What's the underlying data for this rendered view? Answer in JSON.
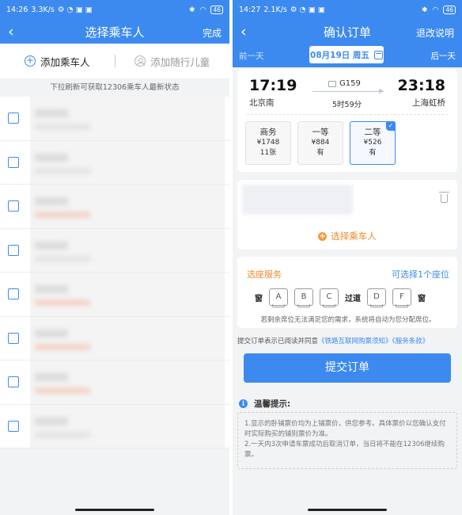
{
  "left": {
    "status": {
      "time": "14:26",
      "speed": "3.3K/s",
      "battery": "46"
    },
    "nav": {
      "back": "‹",
      "title": "选择乘车人",
      "done": "完成"
    },
    "add": {
      "add_passenger": "添加乘车人",
      "add_child": "添加随行儿童"
    },
    "hint": "下拉刷新可获取12306乘车人最新状态",
    "passengers": [
      {
        "name": "",
        "id": ""
      },
      {
        "name": "",
        "id": ""
      },
      {
        "name": "",
        "id": ""
      },
      {
        "name": "",
        "id": ""
      },
      {
        "name": "",
        "id": ""
      },
      {
        "name": "",
        "id": ""
      },
      {
        "name": "",
        "id": ""
      },
      {
        "name": "",
        "id": ""
      }
    ]
  },
  "right": {
    "status": {
      "time": "14:27",
      "speed": "2.1K/s",
      "battery": "46"
    },
    "nav": {
      "back": "‹",
      "title": "确认订单",
      "refund": "退改说明"
    },
    "date": {
      "prev": "前一天",
      "current": "08月19日 周五",
      "next": "后一天"
    },
    "train": {
      "depart_time": "17:19",
      "depart_station": "北京南",
      "arrive_time": "23:18",
      "arrive_station": "上海虹桥",
      "number": "G159",
      "duration": "5时59分"
    },
    "seats": [
      {
        "name": "商务",
        "price": "¥1748",
        "avail": "11张",
        "selected": false
      },
      {
        "name": "一等",
        "price": "¥884",
        "avail": "有",
        "selected": false
      },
      {
        "name": "二等",
        "price": "¥526",
        "avail": "有",
        "selected": true
      }
    ],
    "select_passenger": "选择乘车人",
    "service": {
      "title": "选座服务",
      "limit": "可选择1个座位",
      "window": "窗",
      "aisle": "过道",
      "seats": [
        "A",
        "B",
        "C",
        "D",
        "F"
      ],
      "note": "若剩余席位无法满足您的需求，系统将自动为您分配席位。"
    },
    "agree": {
      "prefix": "提交订单表示已阅读并同意",
      "link": "《铁路互联网购票须知》《服务条款》"
    },
    "submit": "提交订单",
    "tips": {
      "title": "温馨提示:",
      "line1": "1.显示的卧铺票价均为上铺票价，供您参考。具体票价以您确认支付时实际购买的铺别票价为准。",
      "line2": "2.一天内3次申请车票成功后取消订单，当日将不能在12306继续购票。"
    },
    "colors": {
      "primary": "#3c8af0",
      "accent": "#f08a2d"
    }
  }
}
